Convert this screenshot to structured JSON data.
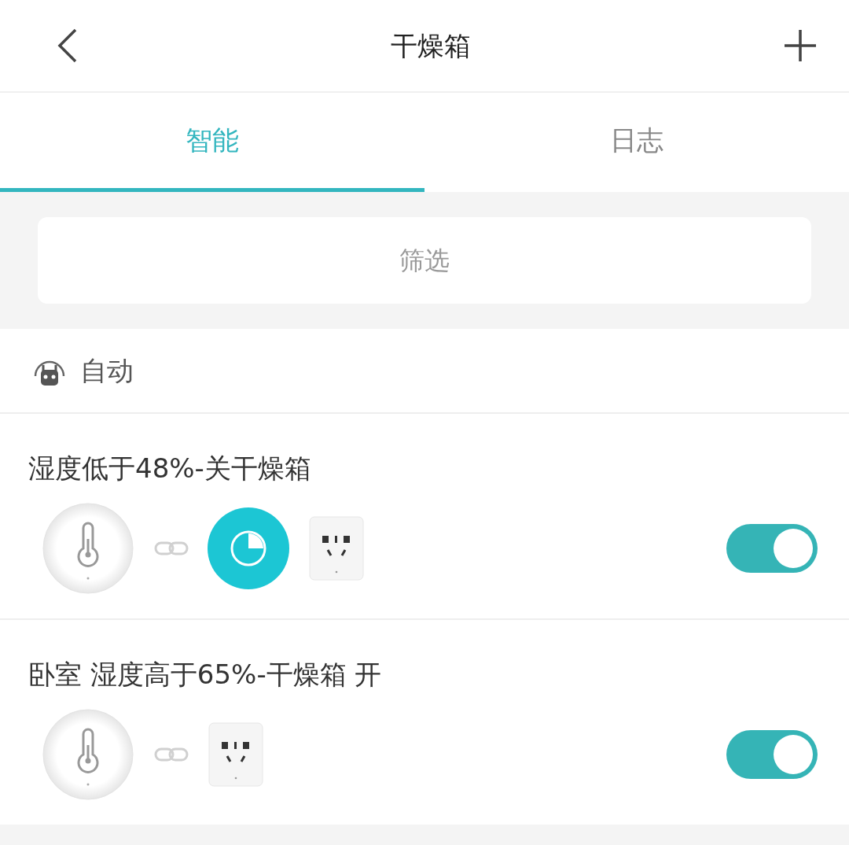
{
  "header": {
    "title": "干燥箱"
  },
  "tabs": [
    {
      "label": "智能",
      "selected": true
    },
    {
      "label": "日志",
      "selected": false
    }
  ],
  "filter": {
    "label": "筛选"
  },
  "section": {
    "title": "自动"
  },
  "rules": [
    {
      "title": "湿度低于48%-关干燥箱",
      "on": true,
      "devices": [
        {
          "kind": "sensor"
        },
        {
          "kind": "link"
        },
        {
          "kind": "timer"
        },
        {
          "kind": "plug"
        }
      ]
    },
    {
      "title": "卧室 湿度高于65%-干燥箱 开",
      "on": true,
      "devices": [
        {
          "kind": "sensor"
        },
        {
          "kind": "link"
        },
        {
          "kind": "plug"
        }
      ]
    }
  ]
}
